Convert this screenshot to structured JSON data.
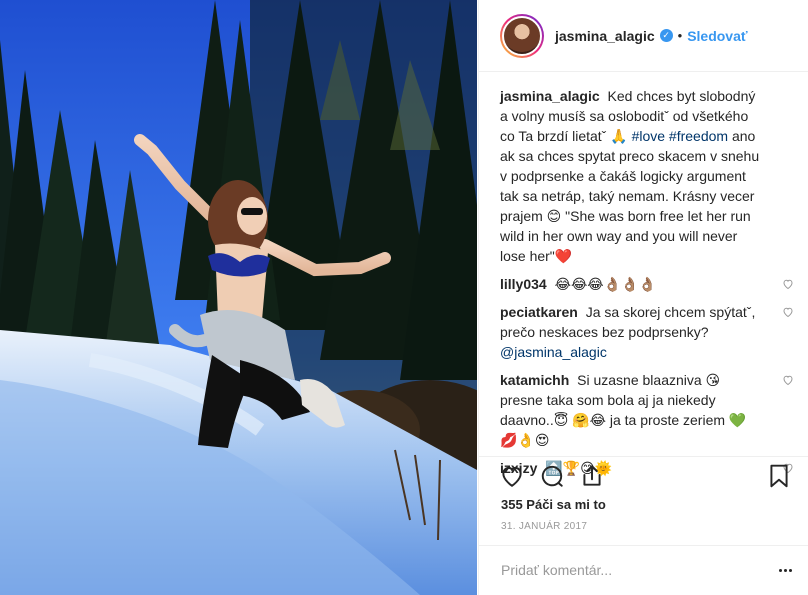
{
  "post": {
    "username": "jasmina_alagic",
    "follow_label": "Sledovať",
    "separator": "•",
    "verified_icon": "verified-badge-icon"
  },
  "caption": {
    "username": "jasmina_alagic",
    "text_1": "Ked chces byt slobodný a volny musíš sa osloboditˇ od všetkého co Ta brzdí lietatˇ 🙏",
    "tag_love": "#love",
    "tag_freedom": "#freedom",
    "text_2": "ano ak sa chces spytat preco skacem v snehu v podprsenke a čakáš logicky argument tak sa netráp, taký nemam. Krásny vecer prajem 😊 \"She was born free let her run wild in her own way and you will never lose her\"❤️"
  },
  "comments": [
    {
      "username": "lilly034",
      "text": "😂😂😂👌🏽👌🏽👌🏽",
      "mention": ""
    },
    {
      "username": "peciatkaren",
      "text": "Ja sa skorej chcem spýtatˇ, prečo neskaces bez podprsenky?",
      "mention": "@jasmina_alagic"
    },
    {
      "username": "katamichh",
      "text": "Si uzasne blaazniva 😘 presne taka som bola aj ja niekedy daavno..😇 🤗😂 ja ta proste zeriem 💚💋👌😍",
      "mention": ""
    },
    {
      "username": "izxizy",
      "text": "🔝🏆😊🌞",
      "mention": ""
    }
  ],
  "likes_text": "355 Páči sa mi to",
  "date_text": "31. JANUÁR 2017",
  "add_comment_placeholder": "Pridať komentár...",
  "icons": {
    "like": "heart-icon",
    "comment": "comment-icon",
    "share": "share-icon",
    "save": "bookmark-icon",
    "more": "more-options-icon"
  },
  "colors": {
    "link_blue": "#3897f0",
    "hashtag": "#003569",
    "heart_red": "#ed4956",
    "muted": "#999999"
  }
}
